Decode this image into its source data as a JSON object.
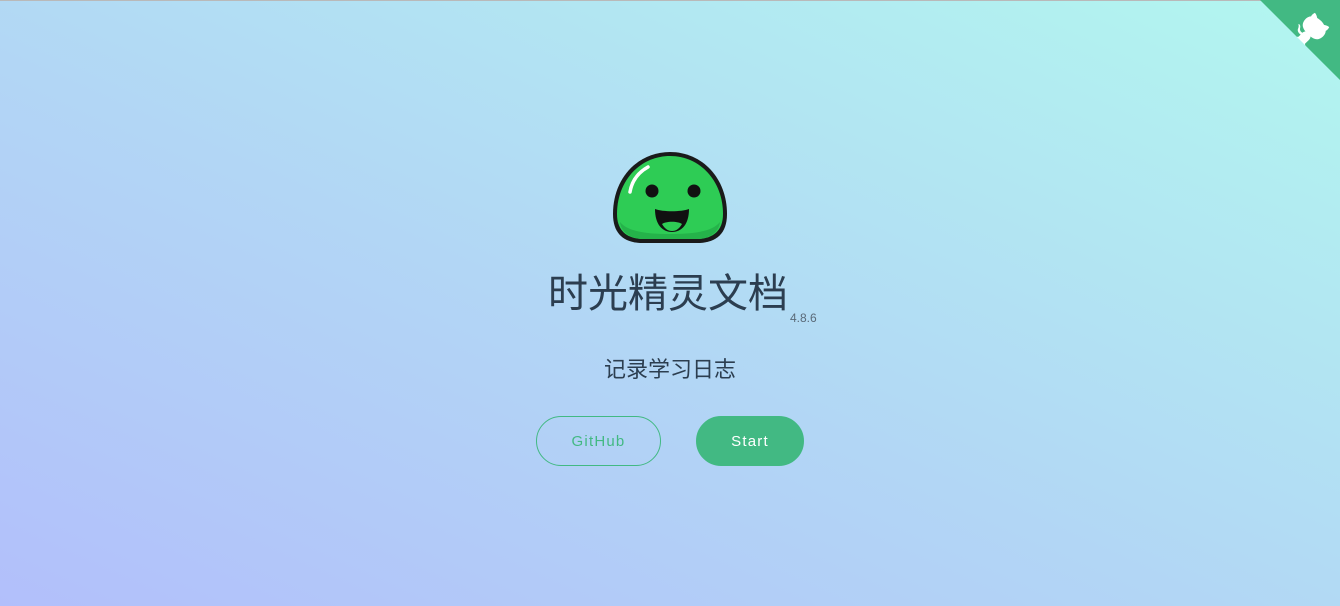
{
  "cover": {
    "title": "时光精灵文档",
    "version": "4.8.6",
    "subtitle": "记录学习日志",
    "buttons": {
      "github_label": "GitHub",
      "start_label": "Start"
    }
  },
  "corner": {
    "icon": "github-octocat-icon",
    "color": "#42b983"
  },
  "logo": {
    "icon": "green-slime-mascot-icon",
    "color": "#2ecc55"
  },
  "colors": {
    "accent": "#42b983",
    "text": "#2c3e50",
    "gradient_start": "#b2bffb",
    "gradient_end": "#b2f7ef"
  }
}
